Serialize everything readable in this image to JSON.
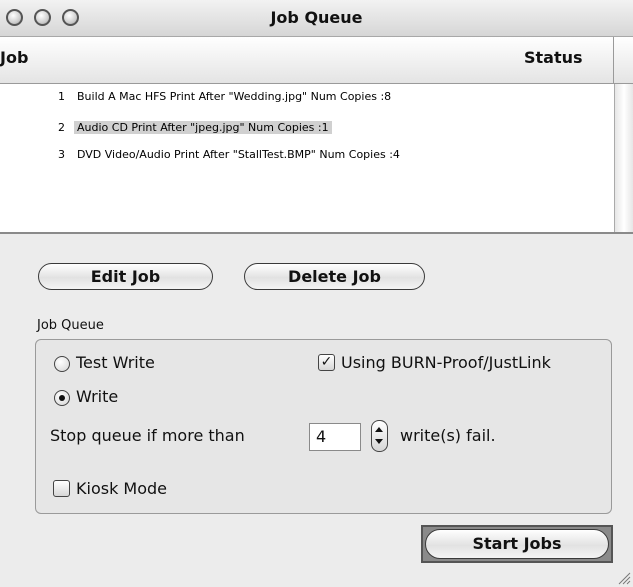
{
  "window": {
    "title": "Job Queue"
  },
  "list": {
    "columns": [
      "Job",
      "Status"
    ],
    "rows": [
      {
        "num": "1",
        "text": "Build A Mac HFS Print After \"Wedding.jpg\"  Num Copies :8",
        "selected": false
      },
      {
        "num": "2",
        "text": "Audio CD Print After \"jpeg.jpg\"  Num Copies :1",
        "selected": true
      },
      {
        "num": "3",
        "text": "DVD Video/Audio Print After \"StallTest.BMP\"  Num Copies :4",
        "selected": false
      }
    ]
  },
  "buttons": {
    "edit_job": "Edit Job",
    "delete_job": "Delete Job",
    "start_jobs": "Start Jobs"
  },
  "job_queue": {
    "group_label": "Job Queue",
    "test_write_label": "Test Write",
    "test_write_selected": false,
    "write_label": "Write",
    "write_selected": true,
    "burnproof_label": "Using BURN-Proof/JustLink",
    "burnproof_checked": true,
    "stop_queue_label": "Stop queue if more than",
    "stop_queue_value": "4",
    "fail_suffix": "write(s) fail.",
    "kiosk_label": "Kiosk Mode",
    "kiosk_checked": false
  },
  "icons": {
    "close": "close-icon",
    "minimize": "minimize-icon",
    "zoom": "zoom-icon",
    "stepper": "stepper-icon",
    "resize": "resize-grip-icon"
  }
}
